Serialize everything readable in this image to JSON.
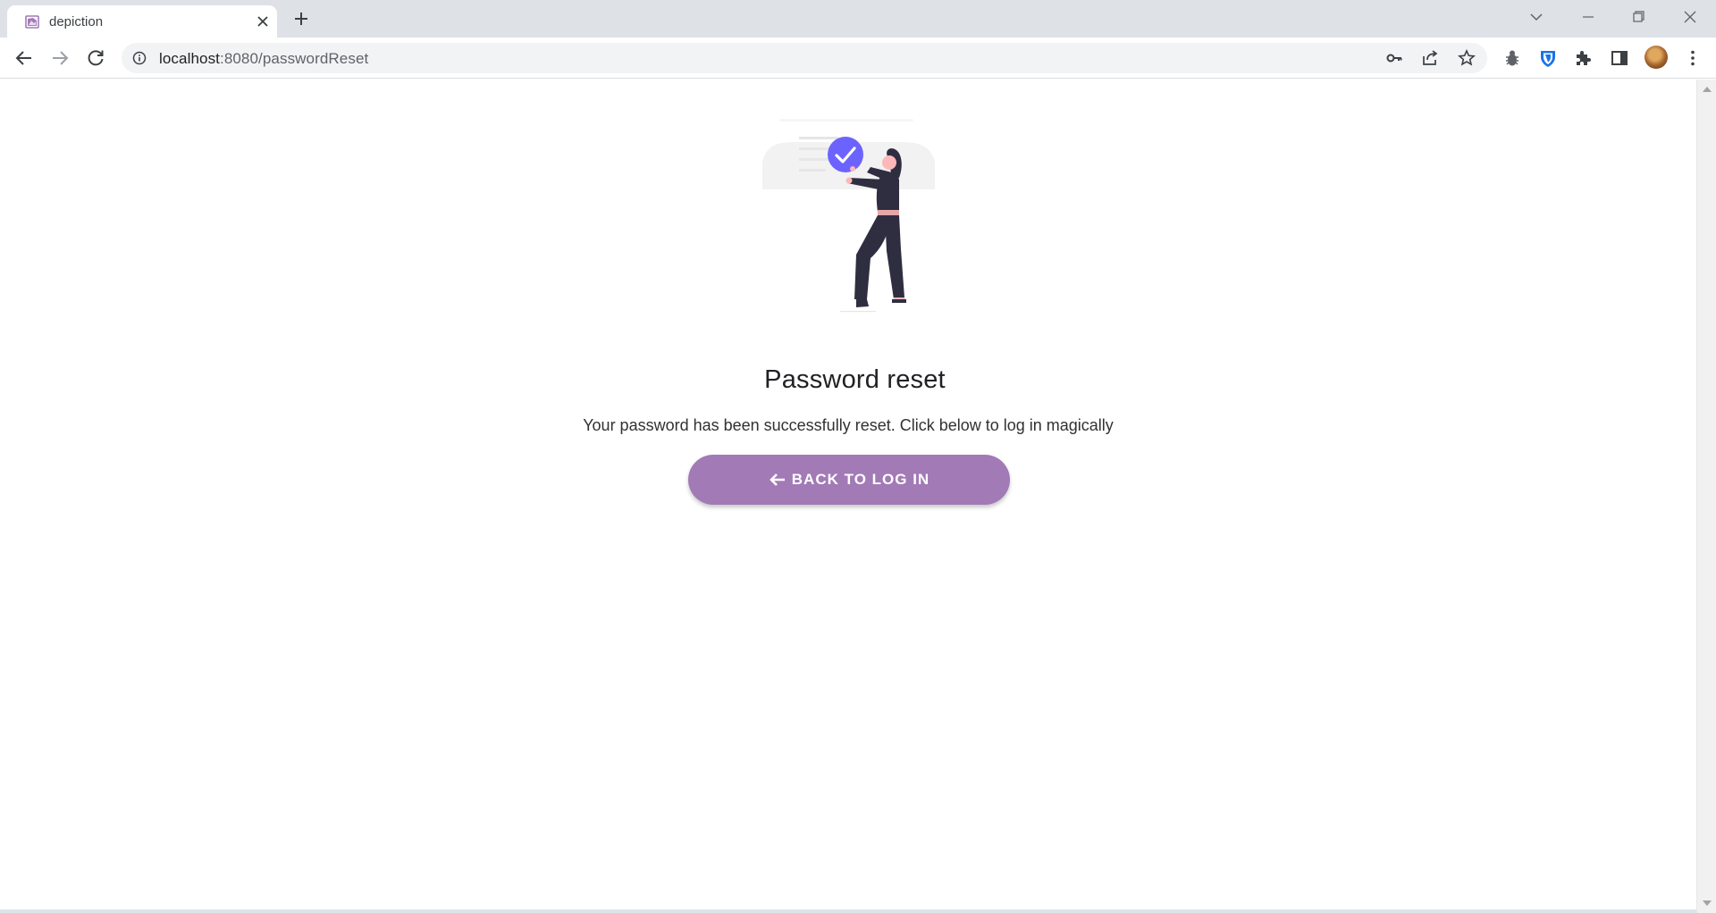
{
  "browser": {
    "tab": {
      "title": "depiction",
      "favicon": "depiction-favicon"
    },
    "address_bar": {
      "host": "localhost",
      "path": ":8080/passwordReset"
    },
    "icons": [
      "back-icon",
      "forward-icon",
      "reload-icon",
      "site-info-icon",
      "key-icon",
      "share-icon",
      "star-icon",
      "bug-icon",
      "shield-icon",
      "puzzle-icon",
      "side-panel-icon",
      "avatar",
      "more-icon"
    ]
  },
  "page": {
    "illustration": "woman-holding-checkmark-illustration",
    "title": "Password reset",
    "message": "Your password has been successfully reset. Click below to log in magically",
    "back_button": {
      "label": "BACK TO LOG IN",
      "icon": "arrow-left-icon"
    }
  },
  "colors": {
    "accent": "#a27ab6",
    "check_badge": "#6c63ff",
    "figure": "#2f2e41",
    "skin": "#ffb8b8",
    "belt": "#e6a7a7"
  }
}
